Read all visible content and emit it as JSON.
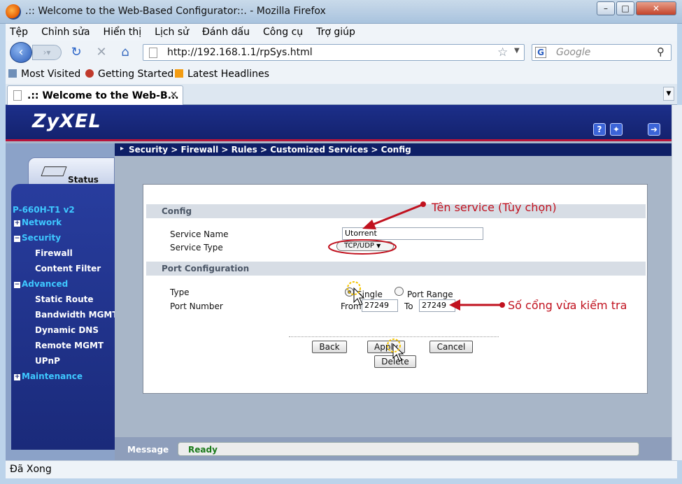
{
  "window": {
    "title": ".:: Welcome to the Web-Based Configurator::. - Mozilla Firefox",
    "controls": [
      "minimize",
      "maximize",
      "close"
    ]
  },
  "menu": [
    "Tệp",
    "Chỉnh sửa",
    "Hiển thị",
    "Lịch sử",
    "Đánh dấu",
    "Công cụ",
    "Trợ giúp"
  ],
  "navigation": {
    "url": "http://192.168.1.1/rpSys.html",
    "search_placeholder": "Google"
  },
  "bookmarks": [
    {
      "label": "Most Visited",
      "icon": "bookmark-icon"
    },
    {
      "label": "Getting Started",
      "icon": "firefox-icon"
    },
    {
      "label": "Latest Headlines",
      "icon": "rss-icon"
    }
  ],
  "tab": {
    "label": ".:: Welcome to the Web-B...",
    "close": "×"
  },
  "router": {
    "brand": "ZyXEL",
    "breadcrumb": "Security > Firewall > Rules > Customized Services > Config",
    "status_label": "Status",
    "model": "P-660H-T1 v2",
    "nav": [
      {
        "label": "Network",
        "type": "section"
      },
      {
        "label": "Security",
        "type": "section"
      },
      {
        "label": "Firewall",
        "type": "item"
      },
      {
        "label": "Content Filter",
        "type": "item"
      },
      {
        "label": "Advanced",
        "type": "section"
      },
      {
        "label": "Static Route",
        "type": "item"
      },
      {
        "label": "Bandwidth MGMT",
        "type": "item"
      },
      {
        "label": "Dynamic DNS",
        "type": "item"
      },
      {
        "label": "Remote MGMT",
        "type": "item"
      },
      {
        "label": "UPnP",
        "type": "item"
      },
      {
        "label": "Maintenance",
        "type": "section"
      }
    ]
  },
  "form": {
    "config_header": "Config",
    "service_name_label": "Service Name",
    "service_name_value": "Utorrent",
    "service_type_label": "Service Type",
    "service_type_value": "TCP/UDP",
    "port_header": "Port Configuration",
    "type_label": "Type",
    "single_label": "Single",
    "range_label": "Port Range",
    "selected_type": "Single",
    "port_number_label": "Port Number",
    "from_label": "From",
    "from_value": "27249",
    "to_label": "To",
    "to_value": "27249",
    "buttons": {
      "back": "Back",
      "apply": "Apply",
      "cancel": "Cancel",
      "delete": "Delete"
    }
  },
  "message": {
    "label": "Message",
    "value": "Ready"
  },
  "status_bar": "Đã Xong",
  "annotations": {
    "service_note": "Tên service (Tùy chọn)",
    "port_note": "Số cổng vừa kiểm tra",
    "color": "#c1121f"
  },
  "colors": {
    "header_blue": "#14226e",
    "accent_red": "#b8143a",
    "nav_cyan": "#3ec8ff",
    "ready_green": "#1a7a1a"
  }
}
